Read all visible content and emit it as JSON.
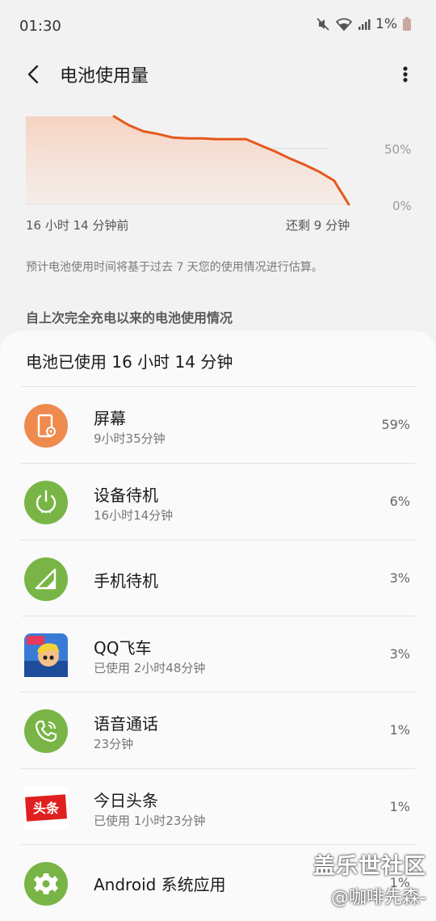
{
  "status_bar": {
    "time": "01:30",
    "battery": "1%",
    "icons": [
      "mute-icon",
      "wifi-icon",
      "signal-icon",
      "battery-icon"
    ]
  },
  "app_bar": {
    "title": "电池使用量",
    "back_icon": "chevron-left-icon",
    "menu_icon": "more-vertical-icon"
  },
  "chart_data": {
    "type": "area",
    "y_ticks": [
      "50%",
      "0%"
    ],
    "ylim": [
      0,
      100
    ],
    "x_start_label": "16 小时 14 分钟前",
    "x_end_label": "还剩 9 分钟",
    "series": [
      {
        "values": [
          100,
          100,
          100,
          100,
          100,
          100,
          100,
          90,
          83,
          80,
          76,
          75,
          75,
          74,
          74,
          74,
          67,
          60,
          52,
          45,
          37,
          27,
          0
        ]
      }
    ],
    "color": "#e4591c",
    "fill_color": "#f7d9cb"
  },
  "estimate_note": "预计电池使用时间将基于过去 7 天您的使用情况进行估算。",
  "section_title": "自上次完全充电以来的电池使用情况",
  "card": {
    "header": "电池已使用 16 小时 14 分钟",
    "items": [
      {
        "label": "屏幕",
        "sub": "9小时35分钟",
        "pct": "59%",
        "icon": "screen-icon",
        "color": "#ef8a4e"
      },
      {
        "label": "设备待机",
        "sub": "16小时14分钟",
        "pct": "6%",
        "icon": "power-icon",
        "color": "#78b546"
      },
      {
        "label": "手机待机",
        "sub": "",
        "pct": "3%",
        "icon": "signal-strength-icon",
        "color": "#78b546"
      },
      {
        "label": "QQ飞车",
        "sub": "已使用 2小时48分钟",
        "pct": "3%",
        "icon": "qq-speed-app-icon",
        "color": "#3a7bd5"
      },
      {
        "label": "语音通话",
        "sub": "23分钟",
        "pct": "1%",
        "icon": "phone-icon",
        "color": "#78b546"
      },
      {
        "label": "今日头条",
        "sub": "已使用 1小时23分钟",
        "pct": "1%",
        "icon": "toutiao-app-icon",
        "color": "#e02020"
      },
      {
        "label": "Android 系统应用",
        "sub": "",
        "pct": "1%",
        "icon": "gear-icon",
        "color": "#78b546"
      }
    ]
  },
  "watermark": {
    "line1": "盖乐世社区",
    "line2": "@咖啡先森-"
  }
}
